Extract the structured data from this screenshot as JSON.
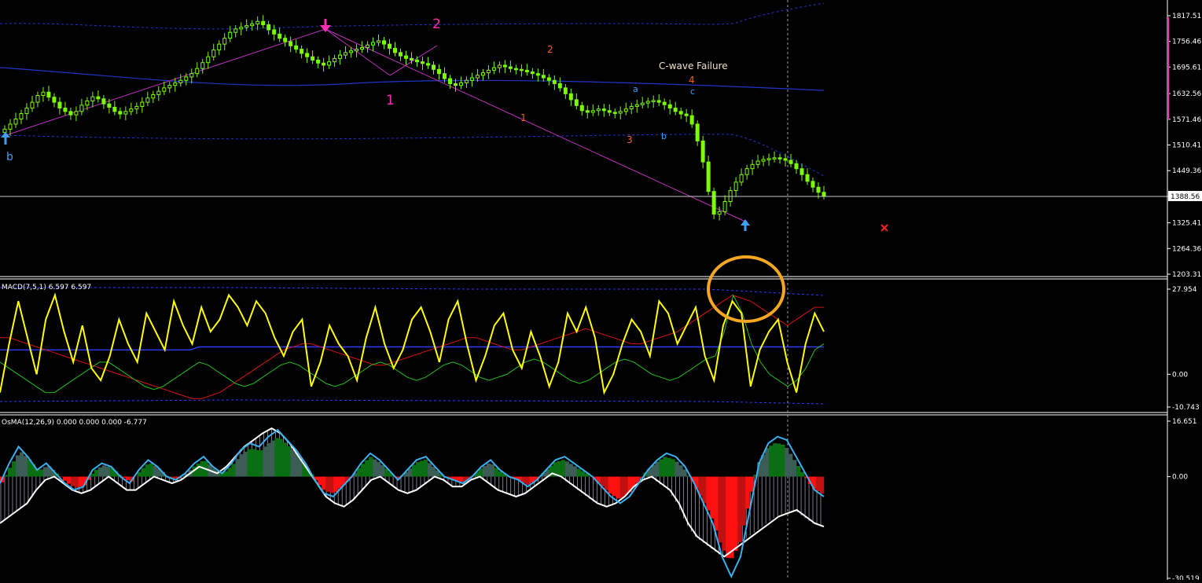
{
  "colors": {
    "background": "#000000",
    "axis_text": "#ffffff",
    "candle": "#7cfc00",
    "bands": "#1f35c8",
    "macd_main": "#ffff00",
    "macd_green": "#22c01c",
    "macd_red": "#d81010",
    "macd_blue": "#2a3cff",
    "osma_pos_green": "#0a6e12",
    "osma_pos_gray": "#3c5c56",
    "osma_neg_red": "#ff1010",
    "osma_neg_dark": "#c01010",
    "osma_cyan": "#3ab0ef",
    "osma_white": "#ffffff",
    "highlight_circle": "#f5a623",
    "pink": "#ff2db4",
    "orange": "#ff5a1e",
    "blue_label": "#3ea0ff"
  },
  "icons": {
    "sell_arrow": "down-arrow-icon",
    "buy_arrow": "up-arrow-icon",
    "close_marker": "x-mark-icon"
  },
  "price_panel": {
    "axis_ticks": [
      "1817.51",
      "1756.46",
      "1695.61",
      "1632.56",
      "1571.46",
      "1510.41",
      "1449.36",
      "1388.56",
      "1325.41",
      "1264.36",
      "1203.31"
    ],
    "current_price_label": "1388.56",
    "wave_labels": [
      {
        "text": "b",
        "color": "blue_label"
      },
      {
        "text": "1",
        "color": "pink"
      },
      {
        "text": "2",
        "color": "pink"
      },
      {
        "text": "1",
        "color": "orange"
      },
      {
        "text": "2",
        "color": "orange"
      },
      {
        "text": "3",
        "color": "orange"
      },
      {
        "text": "4",
        "color": "orange"
      },
      {
        "text": "a",
        "color": "blue_label"
      },
      {
        "text": "b",
        "color": "blue_label"
      },
      {
        "text": "c",
        "color": "blue_label"
      }
    ],
    "annotation": "C-wave Failure"
  },
  "macd_panel": {
    "label": "MACD(7,5,1) 6.597 6.597",
    "axis_ticks": [
      "27.954",
      "0.00",
      "-10.743"
    ]
  },
  "osma_panel": {
    "label": "OsMA(12,26,9) 0.000 0.000 0.000 -6.777",
    "axis_ticks": [
      "16.651",
      "0.00",
      "-30.519"
    ]
  },
  "chart_data": [
    {
      "type": "line",
      "title": "",
      "ylim": [
        1195,
        1840
      ],
      "axis_ticks": [
        1817.51,
        1756.46,
        1695.61,
        1632.56,
        1571.46,
        1510.41,
        1449.36,
        1388.56,
        1325.41,
        1264.36,
        1203.31
      ],
      "series": [
        {
          "values": [
            1548,
            1560,
            1572,
            1585,
            1598,
            1612,
            1628,
            1636,
            1624,
            1612,
            1598,
            1590,
            1582,
            1590,
            1605,
            1615,
            1625,
            1620,
            1608,
            1600,
            1590,
            1584,
            1590,
            1596,
            1602,
            1612,
            1622,
            1630,
            1638,
            1646,
            1652,
            1658,
            1664,
            1672,
            1680,
            1692,
            1706,
            1720,
            1736,
            1750,
            1764,
            1778,
            1786,
            1790,
            1794,
            1798,
            1804,
            1796,
            1784,
            1774,
            1764,
            1756,
            1746,
            1738,
            1728,
            1720,
            1712,
            1705,
            1700,
            1708,
            1716,
            1724,
            1730,
            1734,
            1738,
            1742,
            1748,
            1754,
            1758,
            1750,
            1740,
            1730,
            1722,
            1716,
            1712,
            1708,
            1704,
            1700,
            1690,
            1680,
            1668,
            1656,
            1652,
            1658,
            1664,
            1670,
            1676,
            1682,
            1688,
            1694,
            1700,
            1696,
            1692,
            1690,
            1688,
            1684,
            1680,
            1676,
            1670,
            1664,
            1656,
            1646,
            1632,
            1618,
            1604,
            1592,
            1588,
            1592,
            1596,
            1592,
            1588,
            1586,
            1590,
            1596,
            1602,
            1606,
            1610,
            1614,
            1616,
            1612,
            1606,
            1598,
            1590,
            1584,
            1580,
            1560,
            1520,
            1470,
            1400,
            1346,
            1352,
            1376,
            1402,
            1422,
            1440,
            1454,
            1464,
            1472,
            1476,
            1478,
            1480,
            1478,
            1474,
            1466,
            1454,
            1440,
            1424,
            1410,
            1398,
            1390
          ]
        }
      ]
    },
    {
      "type": "line",
      "title": "",
      "ylim": [
        -10.743,
        27.954
      ],
      "series": [
        {
          "values": [
            -6,
            10,
            24,
            12,
            0,
            18,
            26,
            14,
            4,
            16,
            2,
            -2,
            6,
            18,
            10,
            4,
            20,
            14,
            8,
            24,
            16,
            10,
            22,
            14,
            18,
            26,
            22,
            16,
            24,
            20,
            12,
            6,
            14,
            18,
            -4,
            4,
            16,
            10,
            6,
            -2,
            12,
            22,
            10,
            2,
            8,
            18,
            22,
            14,
            4,
            18,
            24,
            10,
            -2,
            6,
            16,
            20,
            8,
            2,
            14,
            6,
            -4,
            4,
            20,
            14,
            22,
            12,
            -6,
            0,
            10,
            18,
            14,
            6,
            24,
            20,
            10,
            16,
            22,
            6,
            -2,
            16,
            24,
            20,
            -4,
            8,
            14,
            18,
            4,
            -6,
            10,
            20,
            14
          ]
        },
        {
          "values": [
            4,
            2,
            0,
            -2,
            -4,
            -6,
            -6,
            -4,
            -2,
            0,
            2,
            4,
            4,
            2,
            0,
            -2,
            -4,
            -5,
            -4,
            -2,
            0,
            2,
            4,
            3,
            1,
            -1,
            -3,
            -4,
            -3,
            -1,
            1,
            3,
            4,
            3,
            1,
            -1,
            -3,
            -4,
            -3,
            -1,
            1,
            3,
            4,
            3,
            1,
            -1,
            -2,
            -1,
            1,
            3,
            4,
            3,
            1,
            -1,
            -2,
            -1,
            0,
            2,
            4,
            5,
            4,
            2,
            0,
            -2,
            -3,
            -2,
            0,
            2,
            4,
            5,
            4,
            2,
            0,
            -1,
            -2,
            -1,
            1,
            3,
            5,
            6,
            14,
            26,
            20,
            10,
            4,
            0,
            -2,
            -4,
            -2,
            2,
            8,
            10
          ]
        },
        {
          "values": [
            12,
            12,
            11,
            10,
            9,
            8,
            7,
            6,
            5,
            4,
            3,
            2,
            1,
            0,
            -1,
            -2,
            -3,
            -4,
            -5,
            -6,
            -7,
            -8,
            -8,
            -7,
            -6,
            -4,
            -2,
            0,
            2,
            4,
            6,
            8,
            9,
            10,
            10,
            9,
            8,
            7,
            6,
            5,
            4,
            3,
            3,
            4,
            5,
            6,
            7,
            8,
            9,
            10,
            11,
            12,
            12,
            11,
            10,
            9,
            8,
            8,
            9,
            10,
            11,
            12,
            13,
            14,
            15,
            14,
            13,
            12,
            11,
            10,
            10,
            11,
            12,
            13,
            14,
            16,
            18,
            20,
            22,
            24,
            26,
            25,
            24,
            22,
            20,
            18,
            16,
            18,
            20,
            22,
            22
          ]
        },
        {
          "values": [
            8,
            8,
            8,
            8,
            8,
            8,
            8,
            8,
            8,
            8,
            8,
            8,
            8,
            8,
            8,
            8,
            8,
            8,
            8,
            8,
            8,
            8,
            9,
            9,
            9,
            9,
            9,
            9,
            9,
            9,
            9,
            9,
            9,
            9,
            9,
            9,
            9,
            9,
            9,
            9,
            9,
            9,
            9,
            9,
            9,
            9,
            9,
            9,
            9,
            9,
            9,
            9,
            9,
            9,
            9,
            9,
            9,
            9,
            9,
            9,
            9,
            9,
            9,
            9,
            9,
            9,
            9,
            9,
            9,
            9,
            9,
            9,
            9,
            9,
            9,
            9,
            9,
            9,
            9,
            9,
            9,
            9,
            9,
            9,
            9,
            9,
            9,
            9,
            9,
            9,
            9,
            9
          ]
        }
      ]
    },
    {
      "type": "line",
      "title": "",
      "ylim": [
        -30.519,
        16.651
      ],
      "series": [
        {
          "values": [
            -2,
            4,
            9,
            6,
            2,
            4,
            1,
            -2,
            -4,
            -3,
            2,
            4,
            3,
            0,
            -2,
            2,
            5,
            3,
            0,
            -1,
            1,
            4,
            6,
            3,
            1,
            4,
            8,
            10,
            9,
            12,
            14,
            11,
            8,
            4,
            -1,
            -5,
            -6,
            -3,
            0,
            4,
            7,
            5,
            2,
            -1,
            2,
            5,
            6,
            3,
            0,
            -1,
            -2,
            0,
            3,
            5,
            2,
            0,
            -1,
            -3,
            -1,
            2,
            5,
            6,
            4,
            2,
            0,
            -3,
            -6,
            -8,
            -6,
            -2,
            2,
            5,
            7,
            6,
            3,
            -2,
            -8,
            -14,
            -24,
            -30,
            -24,
            -10,
            4,
            10,
            12,
            11,
            6,
            1,
            -4,
            -6
          ]
        },
        {
          "values": [
            -14,
            -12,
            -10,
            -8,
            -4,
            -1,
            0,
            -2,
            -4,
            -5,
            -4,
            -2,
            0,
            -2,
            -4,
            -4,
            -2,
            0,
            -1,
            -2,
            -1,
            1,
            3,
            2,
            1,
            3,
            6,
            9,
            11,
            13,
            14.5,
            13,
            10,
            6,
            2,
            -2,
            -6,
            -8,
            -9,
            -7,
            -4,
            -1,
            0,
            -2,
            -4,
            -5,
            -4,
            -2,
            0,
            -1,
            -3,
            -3,
            -1,
            0,
            -2,
            -4,
            -5,
            -6,
            -5,
            -3,
            -1,
            1,
            0,
            -2,
            -4,
            -6,
            -8,
            -9,
            -8,
            -6,
            -3,
            -1,
            0,
            -2,
            -4,
            -8,
            -14,
            -18,
            -20,
            -22,
            -24,
            -22,
            -20,
            -18,
            -16,
            -14,
            -12,
            -11,
            -10,
            -12,
            -14,
            -15
          ]
        }
      ]
    }
  ]
}
